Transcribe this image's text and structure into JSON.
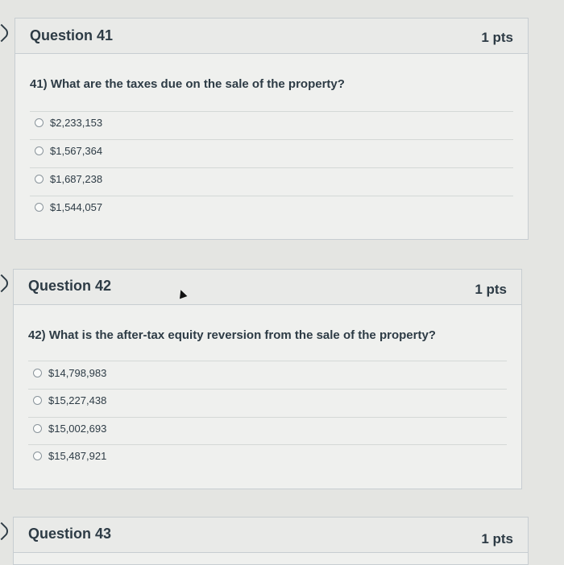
{
  "questions": [
    {
      "title": "Question 41",
      "points": "1 pts",
      "text": "41) What are the taxes due on the sale of the property?",
      "answers": [
        "$2,233,153",
        "$1,567,364",
        "$1,687,238",
        "$1,544,057"
      ]
    },
    {
      "title": "Question 42",
      "points": "1 pts",
      "text": "42) What is the after-tax equity reversion from the sale of the property?",
      "answers": [
        "$14,798,983",
        "$15,227,438",
        "$15,002,693",
        "$15,487,921"
      ]
    },
    {
      "title": "Question 43",
      "points": "1 pts"
    }
  ],
  "icons": {
    "question_marker": "chevron-right-icon",
    "answer_option": "radio-circle-icon",
    "pointer": "mouse-cursor-icon"
  }
}
